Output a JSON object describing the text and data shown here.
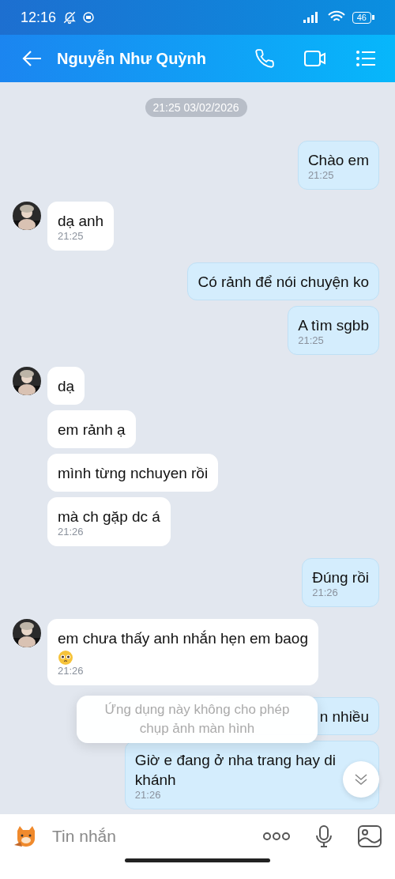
{
  "status_bar": {
    "time": "12:16",
    "battery": "46"
  },
  "header": {
    "title": "Nguyễn Như Quỳnh"
  },
  "date_pill": "21:25 03/02/2026",
  "messages": [
    {
      "outgoing": true,
      "lines": [
        "Chào em"
      ],
      "time": "21:25",
      "emoji": false
    },
    {
      "outgoing": false,
      "lines": [
        "dạ anh"
      ],
      "time": "21:25",
      "avatar": true,
      "emoji": false
    },
    {
      "outgoing": true,
      "lines": [
        "Có rảnh để nói chuyện ko"
      ],
      "emoji": false
    },
    {
      "outgoing": true,
      "lines": [
        "A tìm sgbb"
      ],
      "time": "21:25",
      "emoji": false
    },
    {
      "outgoing": false,
      "lines": [
        "dạ"
      ],
      "avatar": true,
      "emoji": false
    },
    {
      "outgoing": false,
      "lines": [
        "em rảnh ạ"
      ],
      "avatar": false,
      "emoji": false
    },
    {
      "outgoing": false,
      "lines": [
        "mình từng nchuyen rồi"
      ],
      "avatar": false,
      "emoji": false
    },
    {
      "outgoing": false,
      "lines": [
        "mà ch gặp dc á"
      ],
      "time": "21:26",
      "avatar": false,
      "emoji": false
    },
    {
      "outgoing": true,
      "lines": [
        "Đúng rồi"
      ],
      "time": "21:26",
      "emoji": false
    },
    {
      "outgoing": false,
      "lines": [
        "em chưa thấy anh nhắn hẹn em baog"
      ],
      "time": "21:26",
      "avatar": true,
      "emoji": true
    },
    {
      "outgoing": true,
      "lines": [
        "n nhiều"
      ],
      "emoji": false,
      "covered": true
    },
    {
      "outgoing": true,
      "lines": [
        "Giờ e đang ở nha trang hay di",
        "khánh"
      ],
      "time": "21:26",
      "emoji": false,
      "covered": true
    }
  ],
  "toast": {
    "lines": [
      "Ứng dụng này không cho phép",
      "chụp ảnh màn hình"
    ]
  },
  "composer": {
    "placeholder": "Tin nhắn"
  }
}
